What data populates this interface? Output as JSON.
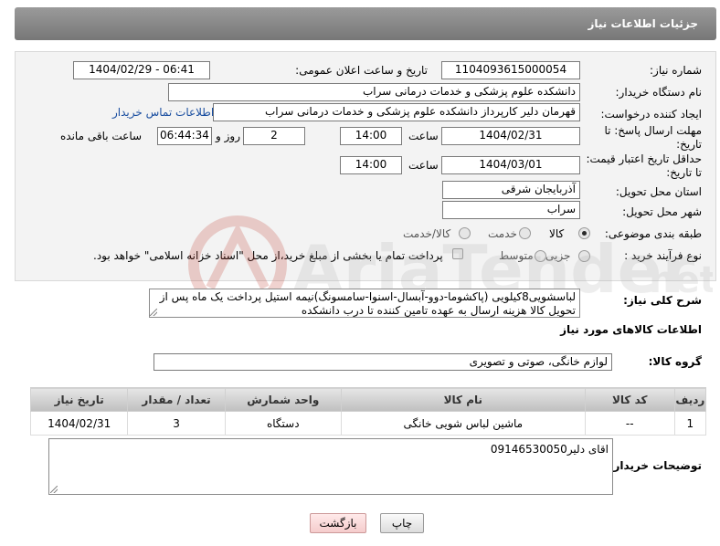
{
  "header": {
    "title": "جزئیات اطلاعات نیاز"
  },
  "form": {
    "need_number": {
      "label": "شماره نیاز:",
      "value": "1104093615000054"
    },
    "announce_datetime": {
      "label": "تاریخ و ساعت اعلان عمومی:",
      "value": "1404/02/29 - 06:41"
    },
    "buyer_org": {
      "label": "نام دستگاه خریدار:",
      "value": "دانشکده علوم پزشکی و خدمات درمانی سراب"
    },
    "requester": {
      "label": "ایجاد کننده درخواست:",
      "value": "قهرمان دلیر کارپرداز دانشکده علوم پزشکی و خدمات درمانی سراب",
      "contact_link": "اطلاعات تماس خریدار"
    },
    "reply_deadline": {
      "label_line1": "مهلت ارسال پاسخ: تا",
      "label_line2": "تاریخ:",
      "date": "1404/02/31",
      "time_label": "ساعت",
      "time": "14:00",
      "days": "2",
      "days_label": "روز و",
      "remaining_time": "06:44:34",
      "remaining_label": "ساعت باقی مانده"
    },
    "price_validity": {
      "label_line1": "حداقل تاریخ اعتبار قیمت:",
      "label_line2": "تا تاریخ:",
      "date": "1404/03/01",
      "time_label": "ساعت",
      "time": "14:00"
    },
    "delivery_province": {
      "label": "استان محل تحویل:",
      "value": "آذربایجان شرقی"
    },
    "delivery_city": {
      "label": "شهر محل تحویل:",
      "value": "سراب"
    },
    "category": {
      "label": "طبقه بندی موضوعی:",
      "options": [
        "کالا",
        "خدمت",
        "کالا/خدمت"
      ],
      "selected": "کالا"
    },
    "purchase_type": {
      "label": "نوع فرآیند خرید :",
      "options": [
        "جزیی",
        "متوسط"
      ],
      "payment_note": "پرداخت تمام یا بخشی از مبلغ خرید،از محل \"اسناد خزانه اسلامی\" خواهد بود."
    }
  },
  "description": {
    "label": "شرح کلی نیاز:",
    "text": "لباسشویی8کیلویی (پاکشوما-دوو-آبسال-اسنوا-سامسونگ)نیمه استیل پرداخت یک ماه پس از تحویل کالا هزینه ارسال به عهده تامین کننده تا درب دانشکده"
  },
  "goods_section": {
    "title": "اطلاعات کالاهای مورد نیاز",
    "group_label": "گروه کالا:",
    "group_value": "لوازم خانگی، صوتی و تصویری"
  },
  "items_table": {
    "headers": [
      "ردیف",
      "کد کالا",
      "نام کالا",
      "واحد شمارش",
      "تعداد / مقدار",
      "تاریخ نیاز"
    ],
    "rows": [
      [
        "1",
        "--",
        "ماشین لباس شویی خانگی",
        "دستگاه",
        "3",
        "1404/02/31"
      ]
    ]
  },
  "buyer_notes": {
    "label": "توضیحات خریدار:",
    "text": "اقای دلیر09146530050"
  },
  "buttons": {
    "print": "چاپ",
    "back": "بازگشت"
  }
}
